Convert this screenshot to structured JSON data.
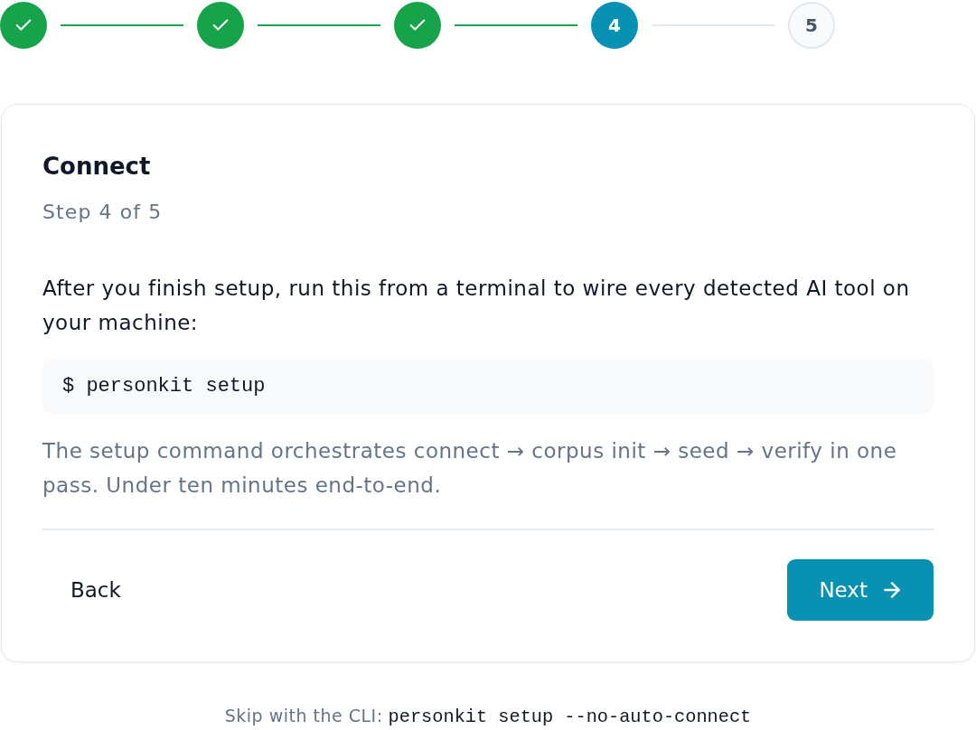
{
  "stepper": {
    "steps": [
      {
        "kind": "done"
      },
      {
        "kind": "done"
      },
      {
        "kind": "done"
      },
      {
        "kind": "active",
        "label": "4"
      },
      {
        "kind": "pending",
        "label": "5"
      }
    ]
  },
  "card": {
    "title": "Connect",
    "subtitle": "Step 4 of 5",
    "intro": "After you finish setup, run this from a terminal to wire every detected AI tool on your machine:",
    "command": "$ personkit setup",
    "note": "The setup command orchestrates connect → corpus init → seed → verify in one pass. Under ten minutes end-to-end.",
    "back_button": "Back",
    "next_button": "Next"
  },
  "footer": {
    "label": "Skip with the CLI:",
    "command": "personkit setup --no-auto-connect"
  }
}
